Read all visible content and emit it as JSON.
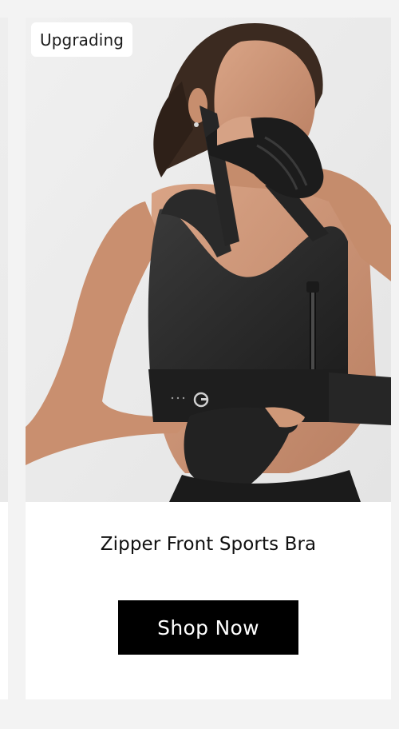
{
  "product": {
    "badge": "Upgrading",
    "title": "Zipper Front Sports Bra",
    "cta_label": "Shop Now"
  }
}
